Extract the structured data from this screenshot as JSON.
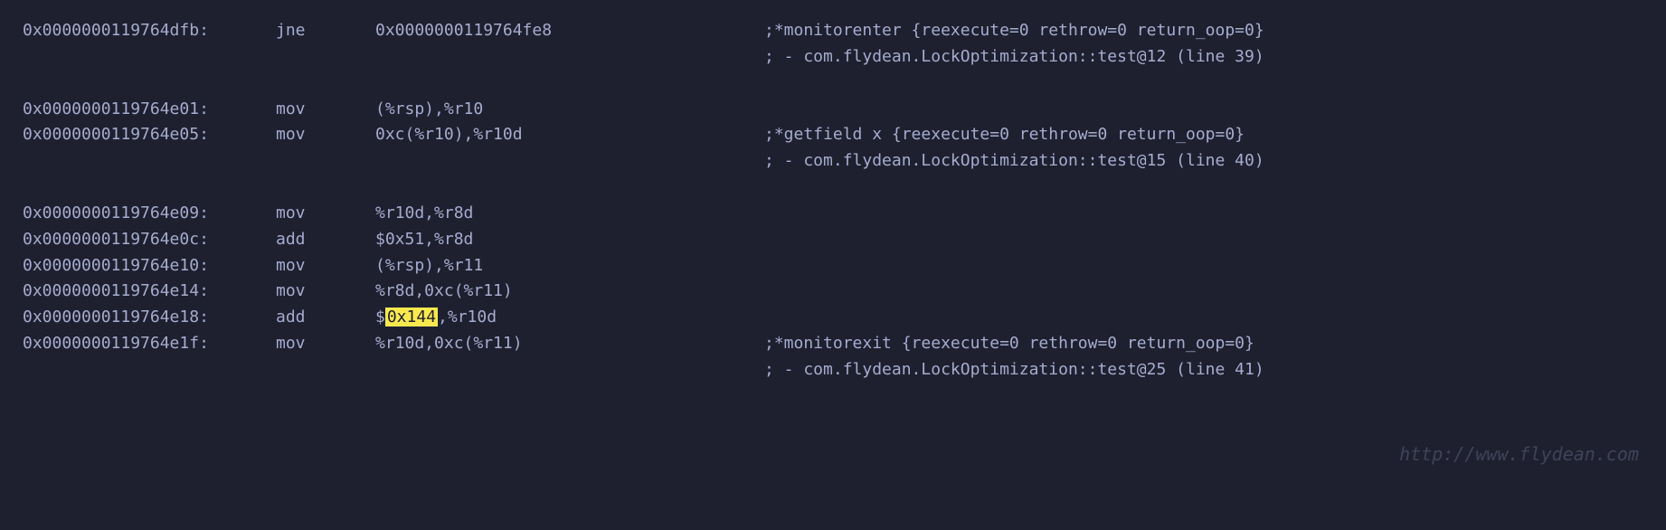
{
  "lines": [
    {
      "address": "0x0000000119764dfb:",
      "mnemonic": "jne",
      "operands": "0x0000000119764fe8",
      "comment": ";*monitorenter {reexecute=0 rethrow=0 return_oop=0}"
    },
    {
      "address": "",
      "mnemonic": "",
      "operands": "",
      "comment": "; - com.flydean.LockOptimization::test@12 (line 39)"
    },
    {
      "address": "0x0000000119764e01:",
      "mnemonic": "mov",
      "operands": "(%rsp),%r10",
      "comment": ""
    },
    {
      "address": "0x0000000119764e05:",
      "mnemonic": "mov",
      "operands": "0xc(%r10),%r10d",
      "comment": ";*getfield x {reexecute=0 rethrow=0 return_oop=0}"
    },
    {
      "address": "",
      "mnemonic": "",
      "operands": "",
      "comment": "; - com.flydean.LockOptimization::test@15 (line 40)"
    },
    {
      "address": "0x0000000119764e09:",
      "mnemonic": "mov",
      "operands": "%r10d,%r8d",
      "comment": ""
    },
    {
      "address": "0x0000000119764e0c:",
      "mnemonic": "add",
      "operands": "$0x51,%r8d",
      "comment": ""
    },
    {
      "address": "0x0000000119764e10:",
      "mnemonic": "mov",
      "operands": "(%rsp),%r11",
      "comment": ""
    },
    {
      "address": "0x0000000119764e14:",
      "mnemonic": "mov",
      "operands": "%r8d,0xc(%r11)",
      "comment": ""
    },
    {
      "address": "0x0000000119764e18:",
      "mnemonic": "add",
      "operands_prefix": "$",
      "operands_highlight": "0x144",
      "operands_suffix": ",%r10d",
      "comment": ""
    },
    {
      "address": "0x0000000119764e1f:",
      "mnemonic": "mov",
      "operands": "%r10d,0xc(%r11)",
      "comment": ";*monitorexit {reexecute=0 rethrow=0 return_oop=0}"
    },
    {
      "address": "",
      "mnemonic": "",
      "operands": "",
      "comment": "; - com.flydean.LockOptimization::test@25 (line 41)"
    }
  ],
  "watermark": "http://www.flydean.com"
}
